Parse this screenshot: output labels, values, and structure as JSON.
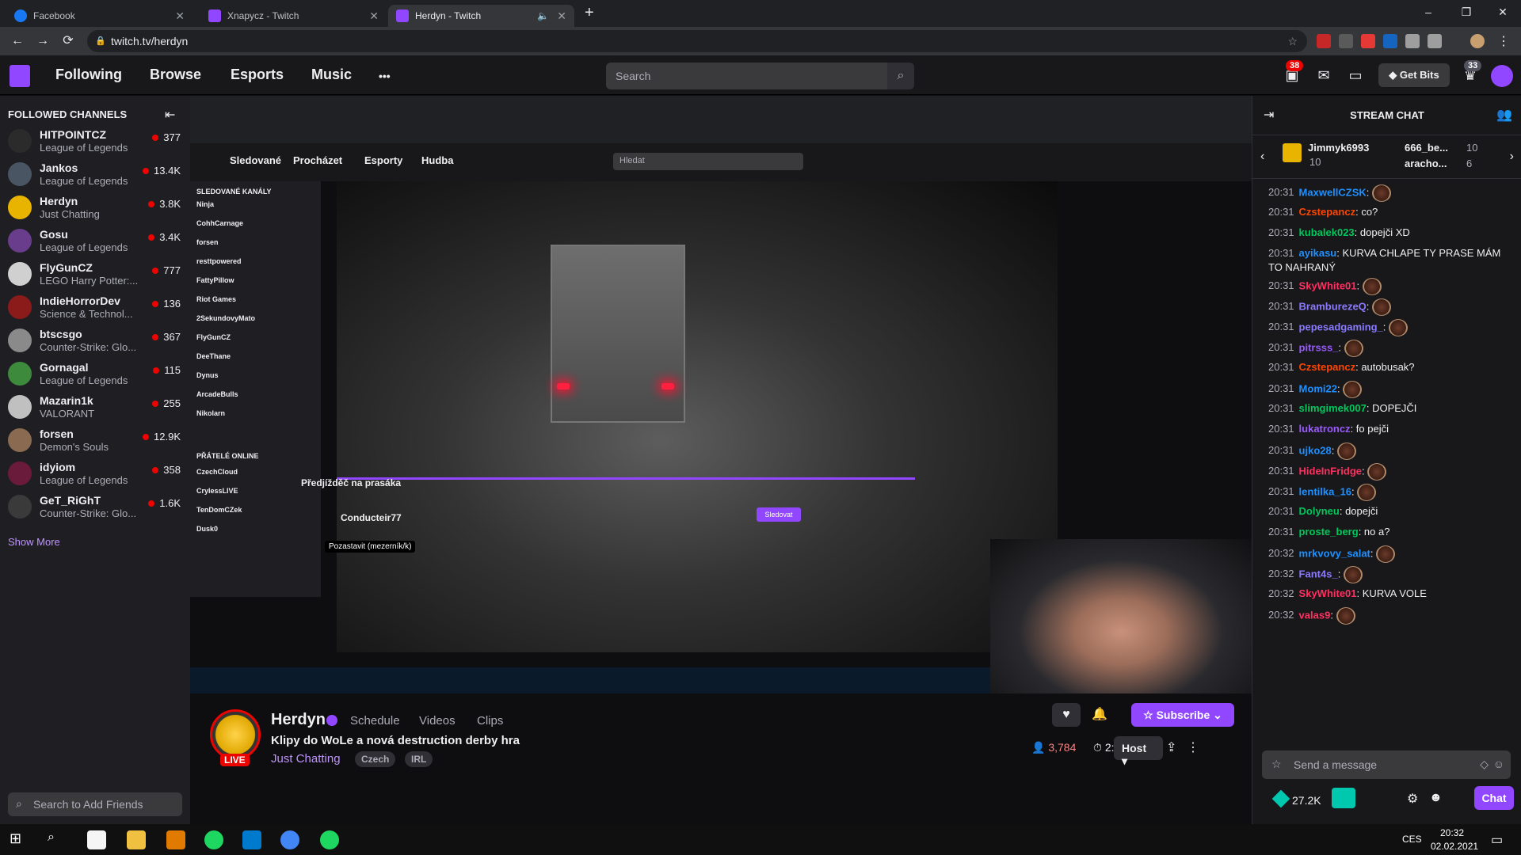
{
  "browser": {
    "tabs": [
      {
        "label": "Facebook"
      },
      {
        "label": "Xnapycz - Twitch"
      },
      {
        "label": "Herdyn - Twitch"
      }
    ],
    "url": "twitch.tv/herdyn",
    "new_tab": "+",
    "window": {
      "minimize": "–",
      "maximize": "❐",
      "close": "✕"
    },
    "nav": {
      "back": "←",
      "forward": "→",
      "reload": "⟳"
    }
  },
  "topnav": {
    "links": [
      "Following",
      "Browse",
      "Esports",
      "Music"
    ],
    "more": "•••",
    "search_placeholder": "Search",
    "notif_count": "38",
    "prime_count": "33",
    "get_bits": "Get Bits"
  },
  "sidebar": {
    "header": "FOLLOWED CHANNELS",
    "channels": [
      {
        "name": "HITPOINTCZ",
        "game": "League of Legends",
        "viewers": "377",
        "color": "#2b2b2b"
      },
      {
        "name": "Jankos",
        "game": "League of Legends",
        "viewers": "13.4K",
        "color": "#4a5563"
      },
      {
        "name": "Herdyn",
        "game": "Just Chatting",
        "viewers": "3.8K",
        "color": "#e8b400"
      },
      {
        "name": "Gosu",
        "game": "League of Legends",
        "viewers": "3.4K",
        "color": "#6a3c8c"
      },
      {
        "name": "FlyGunCZ",
        "game": "LEGO Harry Potter:...",
        "viewers": "777",
        "color": "#d0d0d0"
      },
      {
        "name": "IndieHorrorDev",
        "game": "Science & Technol...",
        "viewers": "136",
        "color": "#8b1a1a"
      },
      {
        "name": "btscsgo",
        "game": "Counter-Strike: Glo...",
        "viewers": "367",
        "color": "#8a8a8a"
      },
      {
        "name": "Gornagal",
        "game": "League of Legends",
        "viewers": "115",
        "color": "#3d8a3d"
      },
      {
        "name": "Mazarin1k",
        "game": "VALORANT",
        "viewers": "255",
        "color": "#c0c0c0"
      },
      {
        "name": "forsen",
        "game": "Demon's Souls",
        "viewers": "12.9K",
        "color": "#8a6a50"
      },
      {
        "name": "idyiom",
        "game": "League of Legends",
        "viewers": "358",
        "color": "#6a1a3a"
      },
      {
        "name": "GeT_RiGhT",
        "game": "Counter-Strike: Glo...",
        "viewers": "1.6K",
        "color": "#3a3a3a"
      }
    ],
    "show_more": "Show More",
    "add_friends": "Search to Add Friends"
  },
  "stream": {
    "name": "Herdyn",
    "live": "LIVE",
    "links": [
      "Schedule",
      "Videos",
      "Clips"
    ],
    "title": "Klipy do WoLe a nová destruction derby hra",
    "category": "Just Chatting",
    "tags": [
      "Czech",
      "IRL"
    ],
    "subscribe": "Subscribe",
    "viewers": "3,784",
    "uptime": "2:04",
    "host": "Host"
  },
  "video_inner": {
    "clip_title": "Předjížděč na prasáka",
    "clip_channel": "Conducteir77",
    "pause_tooltip": "Pozastavit (mezerník/k)",
    "inner_nav": [
      "Sledované",
      "Procházet",
      "Esporty",
      "Hudba"
    ],
    "inner_search": "Hledat",
    "inner_sidebar_header": "SLEDOVANÉ KANÁLY",
    "inner_channels": [
      "Ninja",
      "CohhCarnage",
      "forsen",
      "resttpowered",
      "FattyPillow",
      "Riot Games",
      "2SekundovyMato",
      "FlyGunCZ",
      "DeeThane",
      "Dynus",
      "ArcadeBulls",
      "Nikolarn"
    ],
    "friends_header": "PŘÁTELÉ ONLINE",
    "friends": [
      "CzechCloud",
      "CrylessLIVE",
      "TenDomCZek",
      "Dusk0"
    ],
    "follow": "Sledovat"
  },
  "chat": {
    "title": "STREAM CHAT",
    "gifters": [
      {
        "name": "Jimmyk6993",
        "count": "10"
      },
      {
        "name": "666_be...",
        "count": "10"
      },
      {
        "name": "aracho...",
        "count": "6"
      }
    ],
    "messages": [
      {
        "time": "20:31",
        "user": "MaxwellCZSK",
        "color": "#1e90ff",
        "text": ""
      },
      {
        "time": "20:31",
        "user": "Czstepancz",
        "color": "#ff4500",
        "text": "co?"
      },
      {
        "time": "20:31",
        "user": "kubalek023",
        "color": "#00c85a",
        "text": "dopejči XD"
      },
      {
        "time": "20:31",
        "user": "ayikasu",
        "color": "#1e90ff",
        "text": "KURVA CHLAPE TY PRASE MÁM TO NAHRANÝ"
      },
      {
        "time": "20:31",
        "user": "SkyWhite01",
        "color": "#ff3060",
        "text": ""
      },
      {
        "time": "20:31",
        "user": "BramburezeQ",
        "color": "#8a7aff",
        "text": ""
      },
      {
        "time": "20:31",
        "user": "pepesadgaming_",
        "color": "#8a7aff",
        "text": ""
      },
      {
        "time": "20:31",
        "user": "pitrsss_",
        "color": "#9a5aff",
        "text": ""
      },
      {
        "time": "20:31",
        "user": "Czstepancz",
        "color": "#ff4500",
        "text": "autobusak?"
      },
      {
        "time": "20:31",
        "user": "Momi22",
        "color": "#1e90ff",
        "text": ""
      },
      {
        "time": "20:31",
        "user": "slimgimek007",
        "color": "#00c85a",
        "text": "DOPEJČI"
      },
      {
        "time": "20:31",
        "user": "lukatroncz",
        "color": "#9a5aff",
        "text": "fo pejči"
      },
      {
        "time": "20:31",
        "user": "ujko28",
        "color": "#1e90ff",
        "text": ""
      },
      {
        "time": "20:31",
        "user": "HideInFridge",
        "color": "#ff3060",
        "text": ""
      },
      {
        "time": "20:31",
        "user": "lentilka_16",
        "color": "#1e90ff",
        "text": ""
      },
      {
        "time": "20:31",
        "user": "Dolyneu",
        "color": "#00c85a",
        "text": "dopejči"
      },
      {
        "time": "20:31",
        "user": "proste_berg",
        "color": "#00c85a",
        "text": "no a?"
      },
      {
        "time": "20:32",
        "user": "mrkvovy_salat",
        "color": "#1e90ff",
        "text": ""
      },
      {
        "time": "20:32",
        "user": "Fant4s_",
        "color": "#8a7aff",
        "text": ""
      },
      {
        "time": "20:32",
        "user": "SkyWhite01",
        "color": "#ff3060",
        "text": "KURVA VOLE"
      },
      {
        "time": "20:32",
        "user": "valas9",
        "color": "#ff3060",
        "text": ""
      }
    ],
    "input_placeholder": "Send a message",
    "bits": "27.2K",
    "chat_button": "Chat"
  },
  "taskbar": {
    "time": "20:32",
    "date": "02.02.2021",
    "lang": "CES"
  },
  "colors": {
    "accent": "#9147ff",
    "live": "#eb0400"
  }
}
